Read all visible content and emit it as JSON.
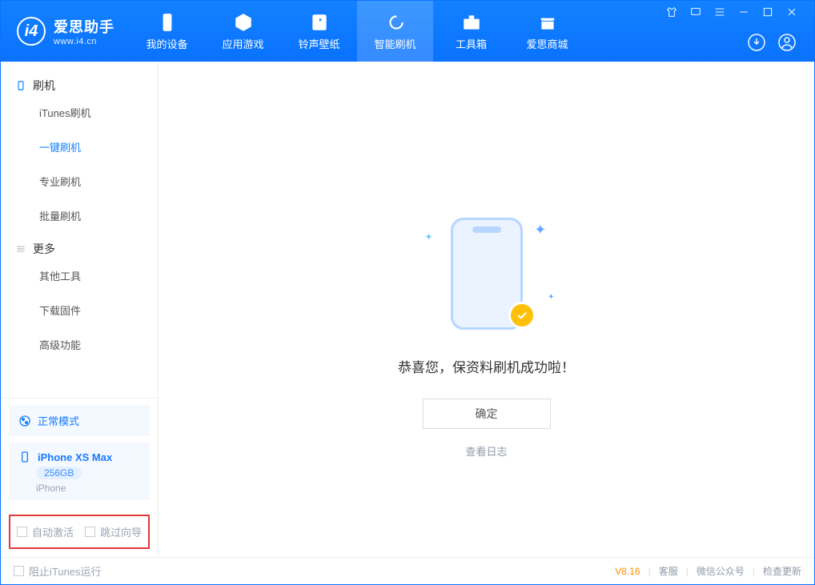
{
  "logo": {
    "chinese": "爱思助手",
    "url": "www.i4.cn"
  },
  "nav": {
    "items": [
      {
        "label": "我的设备"
      },
      {
        "label": "应用游戏"
      },
      {
        "label": "铃声壁纸"
      },
      {
        "label": "智能刷机"
      },
      {
        "label": "工具箱"
      },
      {
        "label": "爱思商城"
      }
    ]
  },
  "sidebar": {
    "group1": {
      "title": "刷机"
    },
    "group1_items": [
      {
        "label": "iTunes刷机"
      },
      {
        "label": "一键刷机"
      },
      {
        "label": "专业刷机"
      },
      {
        "label": "批量刷机"
      }
    ],
    "group2": {
      "title": "更多"
    },
    "group2_items": [
      {
        "label": "其他工具"
      },
      {
        "label": "下载固件"
      },
      {
        "label": "高级功能"
      }
    ],
    "mode_label": "正常模式",
    "device": {
      "name": "iPhone XS Max",
      "capacity": "256GB",
      "type": "iPhone"
    },
    "checks": {
      "auto_activate": "自动激活",
      "skip_guide": "跳过向导"
    }
  },
  "main": {
    "success_msg": "恭喜您，保资料刷机成功啦！",
    "ok_btn": "确定",
    "view_log": "查看日志"
  },
  "footer": {
    "block_itunes": "阻止iTunes运行",
    "version": "V8.16",
    "links": {
      "service": "客服",
      "wechat": "微信公众号",
      "update": "检查更新"
    }
  }
}
